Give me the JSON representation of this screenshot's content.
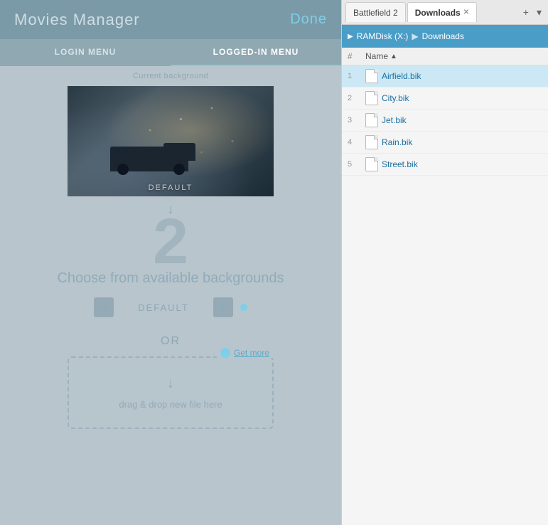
{
  "app": {
    "title": "Movies Manager",
    "done_label": "Done"
  },
  "tabs": {
    "login": "LOGIN MENU",
    "logged_in": "LOGGED-IN MENU"
  },
  "main": {
    "current_bg_label": "Current background",
    "preview_label": "DEFAULT",
    "large_number": "2",
    "choose_text": "Choose from available backgrounds",
    "slider_label": "DEFAULT",
    "or_label": "OR",
    "drop_text": "drag & drop new file here",
    "get_more_label": "Get more"
  },
  "file_browser": {
    "tab_battlefield": "Battlefield 2",
    "tab_downloads": "Downloads",
    "breadcrumb_root": "RAMDisk (X:)",
    "breadcrumb_folder": "Downloads",
    "col_num": "#",
    "col_name": "Name",
    "files": [
      {
        "num": "1",
        "name": "Airfield.bik"
      },
      {
        "num": "2",
        "name": "City.bik"
      },
      {
        "num": "3",
        "name": "Jet.bik"
      },
      {
        "num": "4",
        "name": "Rain.bik"
      },
      {
        "num": "5",
        "name": "Street.bik"
      }
    ]
  }
}
